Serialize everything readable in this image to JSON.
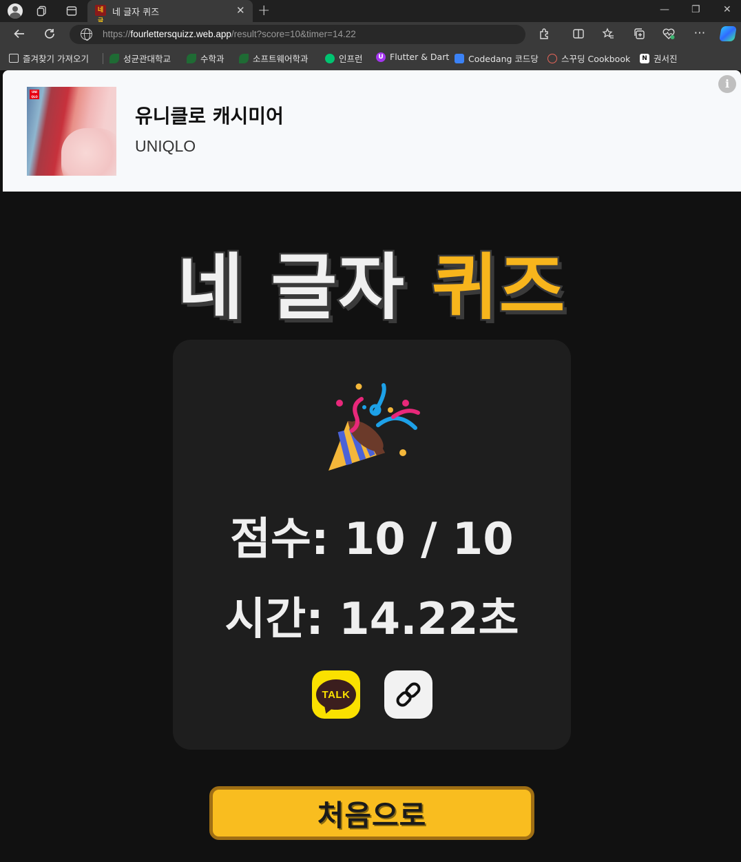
{
  "browser": {
    "tab_title": "네 글자 퀴즈",
    "tab_favicon_text": "네글",
    "url_scheme": "https://",
    "url_host": "fourlettersquizz.web.app",
    "url_path": "/result?score=10&timer=14.22",
    "bookmarks": [
      {
        "label": "즐겨찾기 가져오기",
        "icon": "import-favorites-icon",
        "color": "#3a3a3a"
      },
      {
        "label": "성균관대학교",
        "icon": "skku-icon",
        "color": "#2e7d32"
      },
      {
        "label": "수학과",
        "icon": "skku-icon",
        "color": "#2e7d32"
      },
      {
        "label": "소프트웨어학과",
        "icon": "skku-icon",
        "color": "#2e7d32"
      },
      {
        "label": "인프런",
        "icon": "inflearn-icon",
        "color": "#00c471"
      },
      {
        "label": "Flutter & Dart",
        "icon": "udemy-icon",
        "color": "#a435f0"
      },
      {
        "label": "Codedang 코드당",
        "icon": "codedang-icon",
        "color": "#3b82f6"
      },
      {
        "label": "스꾸딩 Cookbook",
        "icon": "cookbook-icon",
        "color": "#e8665a"
      },
      {
        "label": "권서진",
        "icon": "notion-icon",
        "color": "#ffffff"
      }
    ]
  },
  "ad": {
    "title": "유니클로 캐시미어",
    "brand": "UNIQLO",
    "image_logo": "UNI QLO",
    "info_label": "i"
  },
  "quiz": {
    "title_plain": "네 글자 ",
    "title_accent": "퀴즈",
    "score_text": "점수: 10 / 10",
    "time_text": "시간: 14.22초",
    "kakao_label": "TALK",
    "home_button": "처음으로"
  },
  "colors": {
    "accent": "#f7b51c",
    "card": "#1e1e1e",
    "background": "#111111",
    "kakao": "#fae100"
  }
}
